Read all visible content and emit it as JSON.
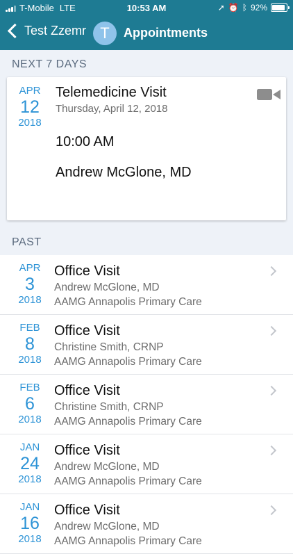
{
  "status_bar": {
    "carrier": "T-Mobile",
    "network": "LTE",
    "time": "10:53 AM",
    "battery_percent": "92%",
    "battery_level": 0.92,
    "icons": [
      "location-arrow-icon",
      "alarm-icon",
      "bluetooth-icon"
    ]
  },
  "nav": {
    "back_label": "Test Zzemr",
    "avatar_initial": "T",
    "title": "Appointments"
  },
  "upcoming": {
    "header": "NEXT 7 DAYS",
    "appointment": {
      "month": "APR",
      "day": "12",
      "year": "2018",
      "title": "Telemedicine Visit",
      "date_text": "Thursday, April 12, 2018",
      "time": "10:00 AM",
      "provider": "Andrew McGlone, MD",
      "icon": "video-camera-icon"
    }
  },
  "past": {
    "header": "PAST",
    "items": [
      {
        "month": "APR",
        "day": "3",
        "year": "2018",
        "title": "Office Visit",
        "provider": "Andrew McGlone, MD",
        "location": "AAMG Annapolis Primary Care"
      },
      {
        "month": "FEB",
        "day": "8",
        "year": "2018",
        "title": "Office Visit",
        "provider": "Christine Smith, CRNP",
        "location": "AAMG Annapolis Primary Care"
      },
      {
        "month": "FEB",
        "day": "6",
        "year": "2018",
        "title": "Office Visit",
        "provider": "Christine Smith, CRNP",
        "location": "AAMG Annapolis Primary Care"
      },
      {
        "month": "JAN",
        "day": "24",
        "year": "2018",
        "title": "Office Visit",
        "provider": "Andrew McGlone, MD",
        "location": "AAMG Annapolis Primary Care"
      },
      {
        "month": "JAN",
        "day": "16",
        "year": "2018",
        "title": "Office Visit",
        "provider": "Andrew McGlone, MD",
        "location": "AAMG Annapolis Primary Care"
      }
    ]
  },
  "colors": {
    "header_bg": "#1e7b93",
    "accent": "#2d93d6",
    "page_bg": "#eef2f8"
  }
}
